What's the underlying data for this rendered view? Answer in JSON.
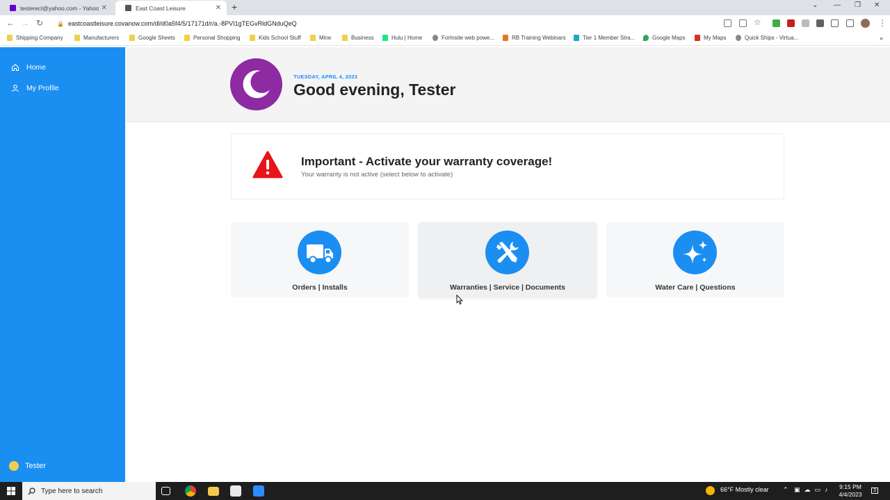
{
  "browser": {
    "tabs": [
      {
        "title": "testerecl@yahoo.com - Yahoo Mail",
        "active": false
      },
      {
        "title": "East Coast Leisure",
        "active": true
      }
    ],
    "url": "eastcoastleisure.covanow.com/dl/d0a5f4/5/17171d/r/a.-8PVI1gTEGvRldGNduQeQ"
  },
  "bookmarks": [
    "Shipping Company",
    "Manufacturers",
    "Google Sheets",
    "Personal Shopping",
    "Kids School Stuff",
    "Mine",
    "Business",
    "Hulu | Home",
    "ForInsite web powe...",
    "RB Training Webinars",
    "Tier 1 Member Stra...",
    "Google Maps",
    "My Maps",
    "Quick Ships - Virtua..."
  ],
  "sidebar": {
    "items": [
      {
        "label": "Home",
        "icon": "home-icon"
      },
      {
        "label": "My Profile",
        "icon": "user-icon"
      }
    ],
    "user": "Tester"
  },
  "header": {
    "date": "TUESDAY, APRIL 4, 2023",
    "greeting": "Good evening, Tester"
  },
  "alert": {
    "title": "Important - Activate your warranty coverage!",
    "subtitle": "Your warranty is not active (select below to activate)"
  },
  "cards": [
    {
      "label": "Orders | Installs",
      "icon": "truck-icon"
    },
    {
      "label": "Warranties | Service | Documents",
      "icon": "tools-icon"
    },
    {
      "label": "Water Care | Questions",
      "icon": "sparkles-icon"
    }
  ],
  "taskbar": {
    "search_placeholder": "Type here to search",
    "weather": "66°F  Mostly clear",
    "time": "9:15 PM",
    "date": "4/4/2023",
    "notifications": "3"
  },
  "colors": {
    "sidebar": "#1b8ef2",
    "moon": "#8e2aa2",
    "warning": "#e8141b"
  }
}
